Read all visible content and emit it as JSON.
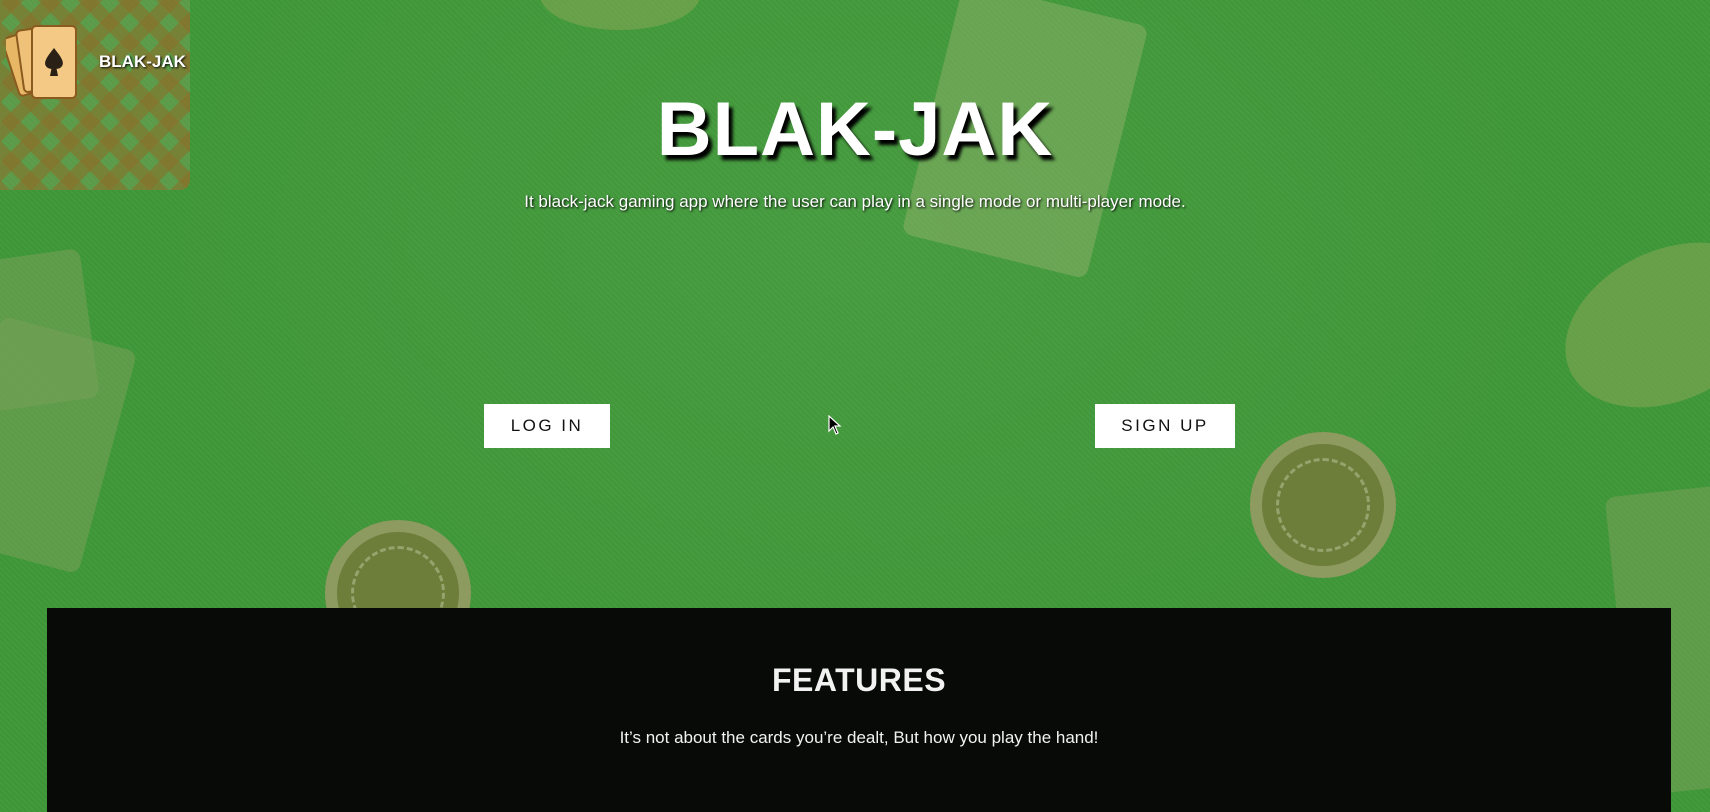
{
  "header": {
    "brand": "BLAK-JAK",
    "logo_icon": "playing-cards-icon"
  },
  "hero": {
    "title": "BLAK-JAK",
    "subtitle": "It black-jack gaming app where the user can play in a single mode or multi-player mode."
  },
  "actions": {
    "login_label": "LOG IN",
    "signup_label": "SIGN UP"
  },
  "features": {
    "title": "FEATURES",
    "tagline": "It’s not about the cards you’re dealt, But how you play the hand!"
  },
  "colors": {
    "felt_green": "#3f9838",
    "features_bg": "#070a06",
    "button_bg": "#ffffff"
  }
}
